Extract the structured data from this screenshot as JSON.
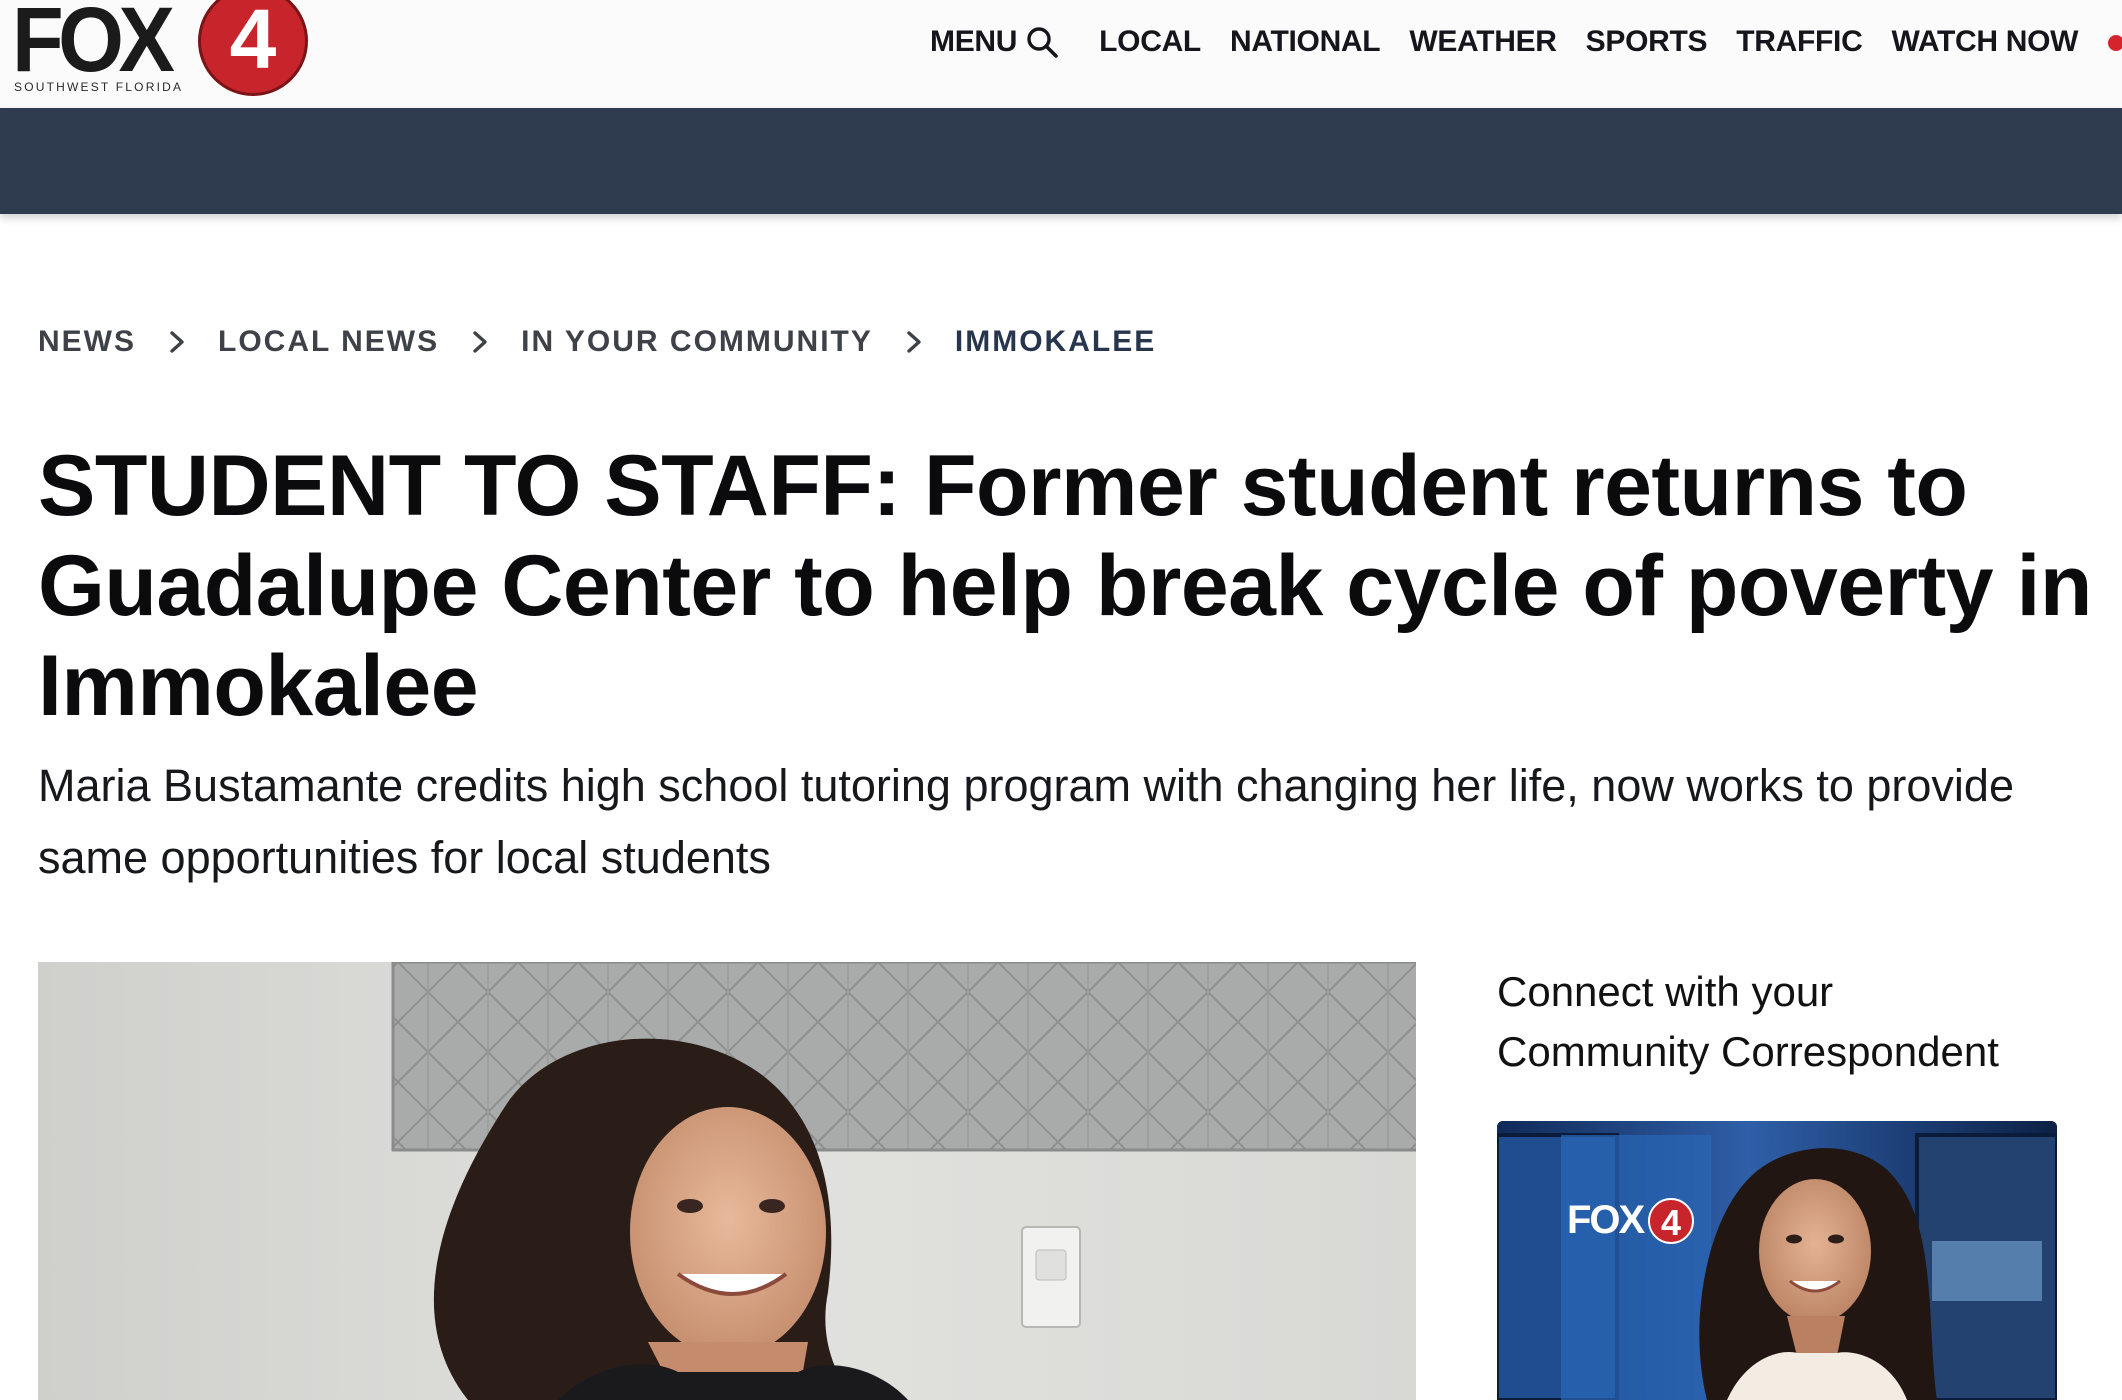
{
  "header": {
    "logo_text": "FOX",
    "logo_number": "4",
    "logo_tagline": "SOUTHWEST FLORIDA",
    "menu_label": "MENU",
    "nav": [
      "LOCAL",
      "NATIONAL",
      "WEATHER",
      "SPORTS",
      "TRAFFIC",
      "WATCH NOW"
    ],
    "colors": {
      "brand_red": "#c7252b",
      "nav_band": "#2f3b4f",
      "live_dot": "#d4252c"
    }
  },
  "breadcrumb": [
    "NEWS",
    "LOCAL NEWS",
    "IN YOUR COMMUNITY",
    "IMMOKALEE"
  ],
  "article": {
    "headline": "STUDENT TO STAFF: Former student returns to Guadalupe Center to help break cycle of poverty in Immokalee",
    "subheadline": "Maria Bustamante credits high school tutoring program with changing her life, now works to provide same opportunities for local students"
  },
  "sidebar": {
    "title": "Connect with your Community Correspondent",
    "photo_logo_text": "FOX",
    "photo_logo_number": "4"
  },
  "icons": {
    "search": "search-icon",
    "chevron": "chevron-right-icon"
  }
}
